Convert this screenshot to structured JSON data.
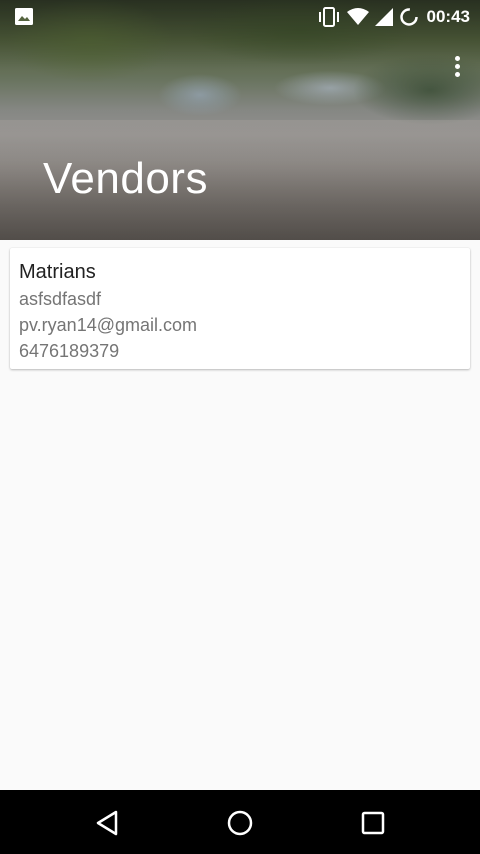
{
  "status_bar": {
    "time": "00:43",
    "icons": [
      "gallery-icon",
      "vibrate-icon",
      "wifi-icon",
      "signal-icon",
      "sync-icon"
    ]
  },
  "header": {
    "title": "Vendors",
    "menu_icon": "overflow-menu-icon"
  },
  "vendors": [
    {
      "name": "Matrians",
      "description": "asfsdfasdf",
      "email": "pv.ryan14@gmail.com",
      "phone": "6476189379"
    }
  ],
  "nav_bar": {
    "icons": [
      "back-icon",
      "home-icon",
      "recents-icon"
    ]
  }
}
